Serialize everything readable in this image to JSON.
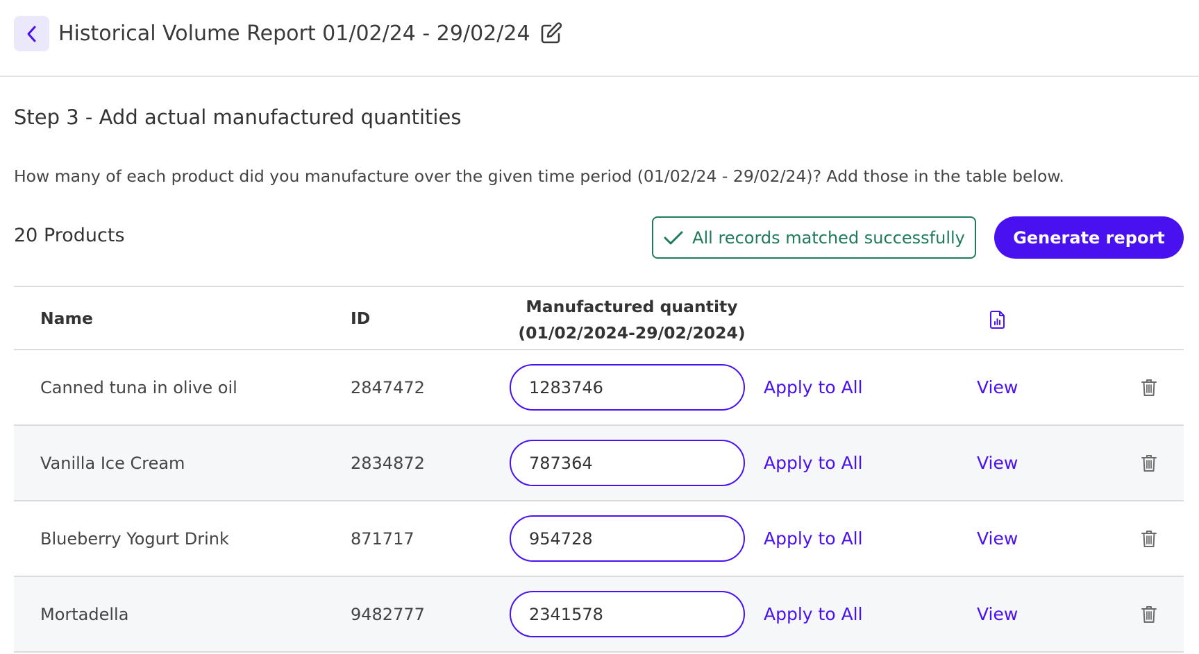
{
  "header": {
    "back_icon": "chevron-left-icon",
    "title": "Historical Volume Report 01/02/24 - 29/02/24",
    "edit_icon": "edit-icon"
  },
  "step": {
    "title": "Step 3 - Add actual manufactured quantities",
    "description": "How many of each product did you manufacture over the given time period (01/02/24 - 29/02/24)? Add those in the table below."
  },
  "toolbar": {
    "product_count": "20 Products",
    "status_badge": "All records matched successfully",
    "status_icon": "check-icon",
    "generate_label": "Generate report"
  },
  "table": {
    "headers": {
      "name": "Name",
      "id": "ID",
      "quantity_line1": "Manufactured quantity",
      "quantity_line2": "(01/02/2024-29/02/2024)",
      "report_icon": "file-chart-icon"
    },
    "apply_label": "Apply to All",
    "view_label": "View",
    "delete_icon": "trash-icon",
    "rows": [
      {
        "name": "Canned tuna in olive oil",
        "id": "2847472",
        "quantity": "1283746"
      },
      {
        "name": "Vanilla Ice Cream",
        "id": "2834872",
        "quantity": "787364"
      },
      {
        "name": "Blueberry Yogurt Drink",
        "id": "871717",
        "quantity": "954728"
      },
      {
        "name": "Mortadella",
        "id": "9482777",
        "quantity": "2341578"
      }
    ]
  },
  "colors": {
    "accent": "#4a11f0",
    "success": "#1f7a5c",
    "back_button_bg": "#ebe8fb",
    "alt_row_bg": "#f6f7f9"
  }
}
